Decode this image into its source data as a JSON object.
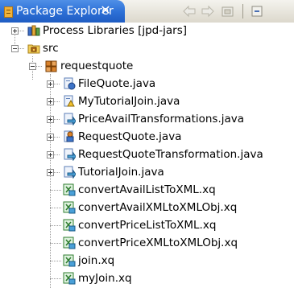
{
  "view": {
    "title": "Package Explorer",
    "close_glyph": "✕",
    "toolbar": {
      "back_icon": "back-arrow-icon",
      "forward_icon": "forward-arrow-icon",
      "home_icon": "home-icon",
      "collapse_icon": "collapse-all-icon"
    }
  },
  "tree": {
    "items": [
      {
        "label": "Process Libraries [jpd-jars]",
        "icon": "library-icon",
        "level": 1,
        "expander": "closed"
      },
      {
        "label": "src",
        "icon": "source-folder-icon",
        "level": 1,
        "expander": "open"
      },
      {
        "label": "requestquote",
        "icon": "package-icon",
        "level": 2,
        "expander": "open"
      },
      {
        "label": "FileQuote.java",
        "icon": "java-process-icon",
        "level": 3,
        "expander": "closed"
      },
      {
        "label": "MyTutorialJoin.java",
        "icon": "java-join-icon",
        "level": 3,
        "expander": "closed"
      },
      {
        "label": "PriceAvailTransformations.java",
        "icon": "java-transform-icon",
        "level": 3,
        "expander": "closed"
      },
      {
        "label": "RequestQuote.java",
        "icon": "java-request-icon",
        "level": 3,
        "expander": "closed"
      },
      {
        "label": "RequestQuoteTransformation.java",
        "icon": "java-transform-icon",
        "level": 3,
        "expander": "closed"
      },
      {
        "label": "TutorialJoin.java",
        "icon": "java-transform-icon",
        "level": 3,
        "expander": "closed"
      },
      {
        "label": "convertAvailListToXML.xq",
        "icon": "xquery-icon",
        "level": 3,
        "expander": "none"
      },
      {
        "label": "convertAvailXMLtoXMLObj.xq",
        "icon": "xquery-icon",
        "level": 3,
        "expander": "none"
      },
      {
        "label": "convertPriceListToXML.xq",
        "icon": "xquery-icon",
        "level": 3,
        "expander": "none"
      },
      {
        "label": "convertPriceXMLtoXMLObj.xq",
        "icon": "xquery-icon",
        "level": 3,
        "expander": "none"
      },
      {
        "label": "join.xq",
        "icon": "xquery-icon",
        "level": 3,
        "expander": "none"
      },
      {
        "label": "myJoin.xq",
        "icon": "xquery-icon",
        "level": 3,
        "expander": "none"
      }
    ]
  },
  "colors": {
    "active_tab": "#2c6fd6",
    "titlebar": "#e6e3da",
    "tree_background": "#ffffff",
    "guide_lines": "#9a9a9a"
  }
}
